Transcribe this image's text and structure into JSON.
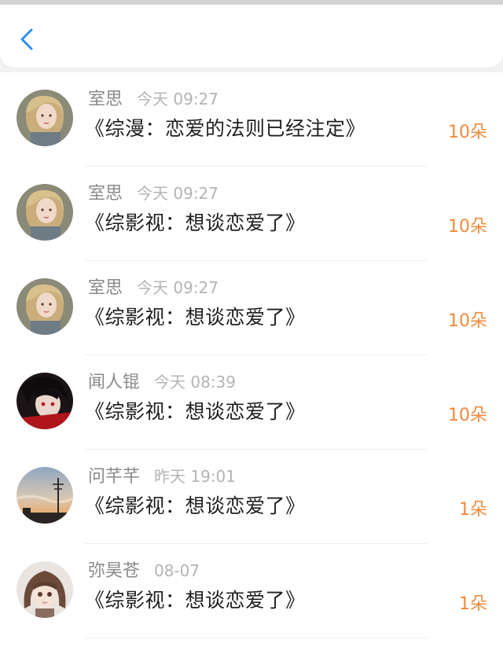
{
  "header": {
    "back_icon": "chevron-left-icon",
    "accent_color": "#2d8ff5"
  },
  "records": [
    {
      "name": "室思",
      "time": "今天 09:27",
      "title": "《综漫：恋爱的法则已经注定》",
      "amount": "10朵",
      "avatar": "avatar-blonde-girl"
    },
    {
      "name": "室思",
      "time": "今天 09:27",
      "title": "《综影视：想谈恋爱了》",
      "amount": "10朵",
      "avatar": "avatar-blonde-girl"
    },
    {
      "name": "室思",
      "time": "今天 09:27",
      "title": "《综影视：想谈恋爱了》",
      "amount": "10朵",
      "avatar": "avatar-blonde-girl"
    },
    {
      "name": "闻人锟",
      "time": "今天 08:39",
      "title": "《综影视：想谈恋爱了》",
      "amount": "10朵",
      "avatar": "avatar-dark-hair-character"
    },
    {
      "name": "问芊芊",
      "time": "昨天 19:01",
      "title": "《综影视：想谈恋爱了》",
      "amount": "1朵",
      "avatar": "avatar-sunset-sky"
    },
    {
      "name": "弥昊苍",
      "time": "08-07",
      "title": "《综影视：想谈恋爱了》",
      "amount": "1朵",
      "avatar": "avatar-brown-hair-girl"
    }
  ],
  "colors": {
    "name": "#8a8a8a",
    "time": "#b4b4b4",
    "title": "#1f1f1f",
    "amount": "#f08a3c"
  }
}
